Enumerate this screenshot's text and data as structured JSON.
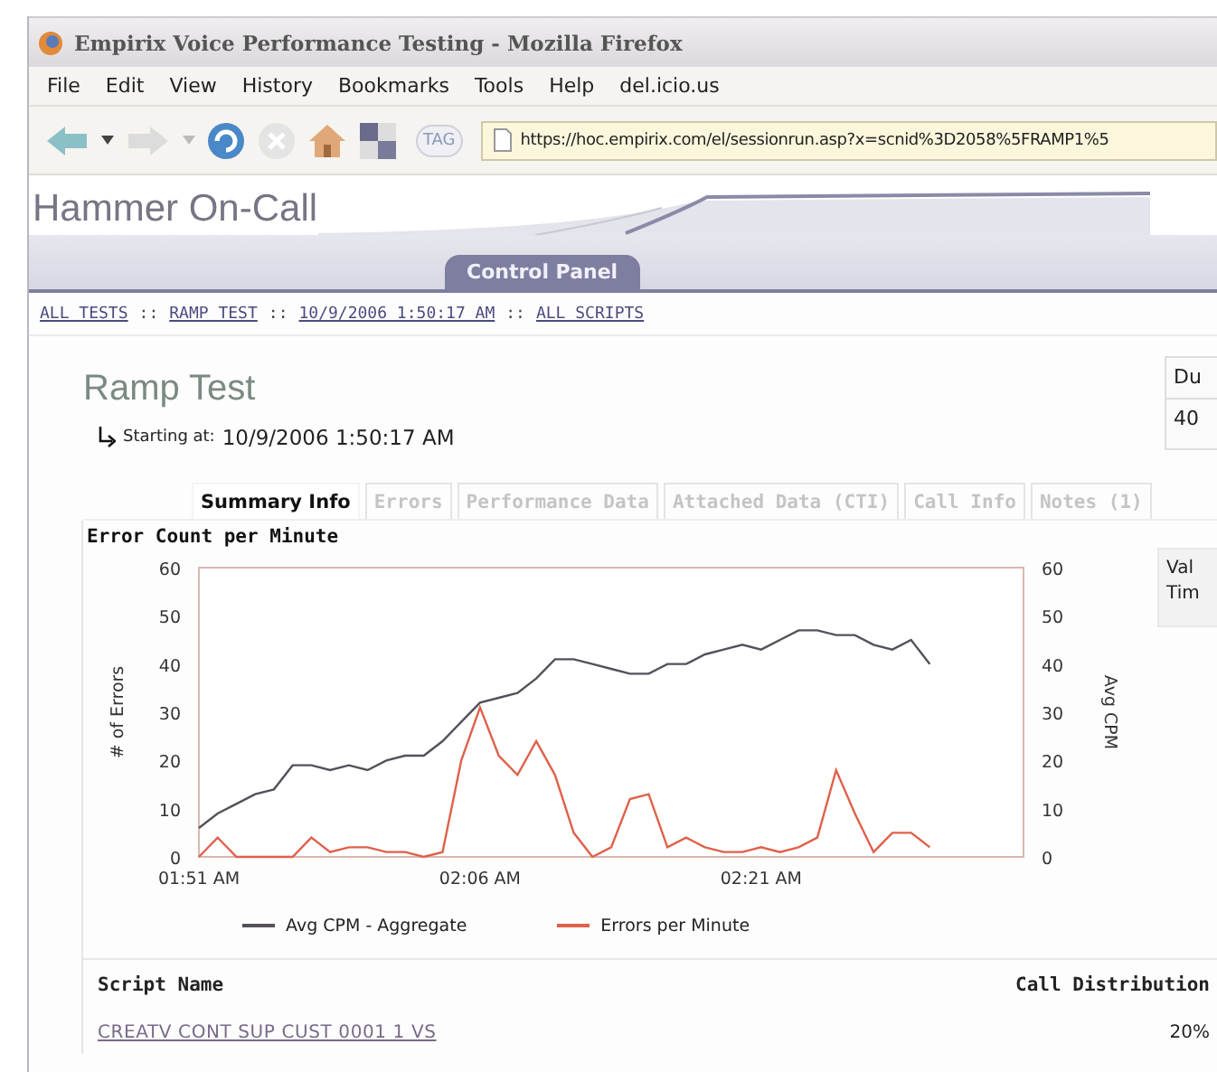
{
  "window": {
    "title": "Empirix Voice Performance Testing - Mozilla Firefox"
  },
  "menu": [
    {
      "label": "File"
    },
    {
      "label": "Edit"
    },
    {
      "label": "View"
    },
    {
      "label": "History"
    },
    {
      "label": "Bookmarks"
    },
    {
      "label": "Tools"
    },
    {
      "label": "Help"
    },
    {
      "label": "del.icio.us"
    }
  ],
  "toolbar": {
    "tag_button": "TAG",
    "address": "https://hoc.empirix.com/el/sessionrun.asp?x=scnid%3D2058%5FRAMP1%5"
  },
  "app": {
    "title": "Hammer On-Call",
    "nav_tabs": [
      {
        "label": "Control Panel",
        "selected": true
      }
    ]
  },
  "breadcrumbs": [
    {
      "label": "ALL TESTS"
    },
    {
      "label": "RAMP TEST"
    },
    {
      "label": "10/9/2006 1:50:17 AM"
    },
    {
      "label": "ALL SCRIPTS"
    }
  ],
  "breadcrumb_separator": "::",
  "test": {
    "title": "Ramp Test",
    "start_label": "Starting at:",
    "start_time": "10/9/2006 1:50:17 AM"
  },
  "side_box": {
    "header": "Du",
    "value": "40"
  },
  "tabs": [
    {
      "label": "Summary Info",
      "selected": true
    },
    {
      "label": "Errors",
      "selected": false
    },
    {
      "label": "Performance Data",
      "selected": false
    },
    {
      "label": "Attached Data (CTI)",
      "selected": false
    },
    {
      "label": "Call Info",
      "selected": false
    },
    {
      "label": "Notes (1)",
      "selected": false
    }
  ],
  "chart": {
    "right_axis_label": "Avg CPM",
    "right_yticks": [
      "60",
      "50",
      "40",
      "30",
      "20",
      "10",
      "0"
    ],
    "chart_data": {
      "type": "line",
      "title": "Error Count per Minute",
      "ylabel": "# of Errors",
      "categories": [
        "01:51 AM",
        null,
        null,
        null,
        null,
        null,
        null,
        null,
        null,
        null,
        null,
        null,
        null,
        null,
        null,
        "02:06 AM",
        null,
        null,
        null,
        null,
        null,
        null,
        null,
        null,
        null,
        null,
        null,
        null,
        null,
        null,
        "02:21 AM",
        null,
        null,
        null,
        null,
        null,
        null,
        null,
        null,
        null
      ],
      "ylim": [
        0,
        60
      ],
      "legend": "bottom",
      "yticks": [
        0,
        10,
        20,
        30,
        40,
        50,
        60
      ],
      "series": [
        {
          "name": "Avg CPM - Aggregate",
          "color": "#55505a",
          "values": [
            6,
            9,
            11,
            13,
            14,
            19,
            19,
            18,
            19,
            18,
            20,
            21,
            21,
            24,
            28,
            32,
            33,
            34,
            37,
            41,
            41,
            40,
            39,
            38,
            38,
            40,
            40,
            42,
            43,
            44,
            43,
            45,
            47,
            47,
            46,
            46,
            44,
            43,
            45,
            40
          ]
        },
        {
          "name": "Errors per Minute",
          "color": "#e0604a",
          "values": [
            0,
            4,
            0,
            0,
            0,
            0,
            4,
            1,
            2,
            2,
            1,
            1,
            0,
            1,
            20,
            31,
            21,
            17,
            24,
            17,
            5,
            0,
            2,
            12,
            13,
            2,
            4,
            2,
            1,
            1,
            2,
            1,
            2,
            4,
            18,
            9,
            1,
            5,
            5,
            2
          ]
        }
      ]
    }
  },
  "legend_box": {
    "line_1": "Val",
    "line_2": "Tim"
  },
  "scripts_table": {
    "columns": [
      "Script Name",
      "Call Distribution"
    ],
    "rows": [
      {
        "name": "CREATV CONT SUP CUST 0001 1 VS",
        "distribution": "20%"
      }
    ]
  }
}
